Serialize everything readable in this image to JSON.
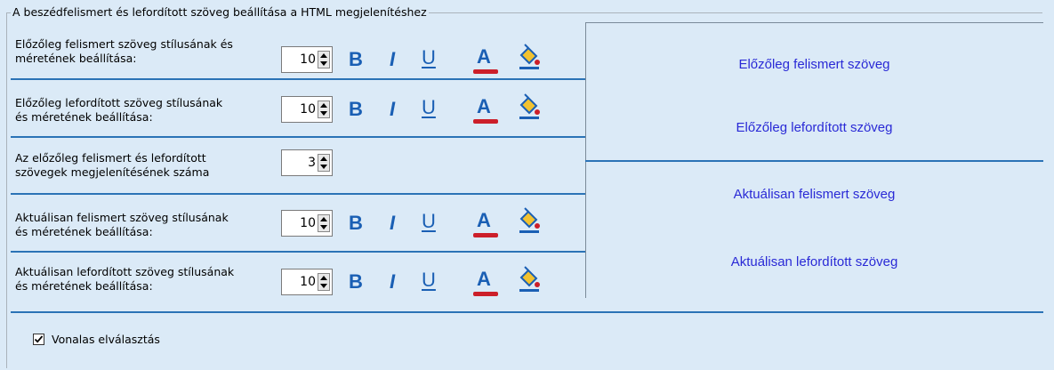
{
  "group_title": "A beszédfelismert és lefordított szöveg beállítása a HTML megjelenítéshez",
  "rows": [
    {
      "label_line1": "Előzőleg felismert szöveg stílusának és",
      "label_line2": "méretének beállítása:",
      "size": "10"
    },
    {
      "label_line1": "Előzőleg lefordított szöveg stílusának",
      "label_line2": "és méretének beállítása:",
      "size": "10"
    },
    {
      "label_line1": "Az előzőleg felismert és lefordított",
      "label_line2": "szövegek megjelenítésének száma",
      "size": "3"
    },
    {
      "label_line1": "Aktuálisan felismert szöveg stílusának",
      "label_line2": "és méretének beállítása:",
      "size": "10"
    },
    {
      "label_line1": "Aktuálisan lefordított szöveg stílusának",
      "label_line2": "és méretének beállítása:",
      "size": "10"
    }
  ],
  "format_buttons": {
    "bold": "B",
    "italic": "I",
    "underline": "U",
    "font_color": "A"
  },
  "preview": {
    "prev_recognized": "Előzőleg felismert szöveg",
    "prev_translated": "Előzőleg lefordított szöveg",
    "cur_recognized": "Aktuálisan felismert szöveg",
    "cur_translated": "Aktuálisan lefordított szöveg"
  },
  "checkbox": {
    "label": "Vonalas elválasztás",
    "checked": true
  },
  "icons": {
    "bucket": "fill-color-bucket-icon",
    "spinner": "spinner-arrows-icon",
    "check": "checkmark-icon"
  },
  "colors": {
    "accent": "#1a5fb4",
    "separator": "#2b73b6",
    "font_color_bar": "#cc1f2a",
    "preview_text": "#2a2ad6",
    "background": "#dbeaf7"
  }
}
